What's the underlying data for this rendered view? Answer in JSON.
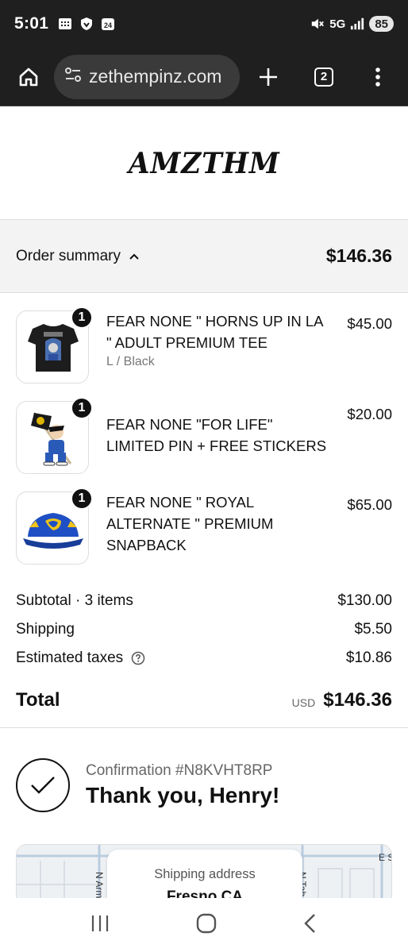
{
  "status_bar": {
    "time": "5:01",
    "network": "5G",
    "battery": "85"
  },
  "browser": {
    "url": "zethempinz.com",
    "tab_count": "2"
  },
  "brand": {
    "logo_text": "AMZTHM"
  },
  "order_summary": {
    "label": "Order summary",
    "total": "$146.36"
  },
  "items": [
    {
      "title": "FEAR NONE \" HORNS UP IN LA \" ADULT PREMIUM TEE",
      "variant": "L / Black",
      "price": "$45.00",
      "qty": "1"
    },
    {
      "title": "FEAR NONE \"FOR LIFE\" LIMITED PIN + FREE STICKERS",
      "variant": "",
      "price": "$20.00",
      "qty": "1"
    },
    {
      "title": "FEAR NONE \" ROYAL ALTERNATE \" PREMIUM SNAPBACK",
      "variant": "",
      "price": "$65.00",
      "qty": "1"
    }
  ],
  "totals": {
    "subtotal_label": "Subtotal · 3 items",
    "subtotal": "$130.00",
    "shipping_label": "Shipping",
    "shipping": "$5.50",
    "taxes_label": "Estimated taxes",
    "taxes": "$10.86",
    "total_label": "Total",
    "currency": "USD",
    "total": "$146.36"
  },
  "confirmation": {
    "number": "Confirmation #N8KVHT8RP",
    "thanks": "Thank you, Henry!"
  },
  "map": {
    "label": "Shipping address",
    "city": "Fresno CA"
  }
}
